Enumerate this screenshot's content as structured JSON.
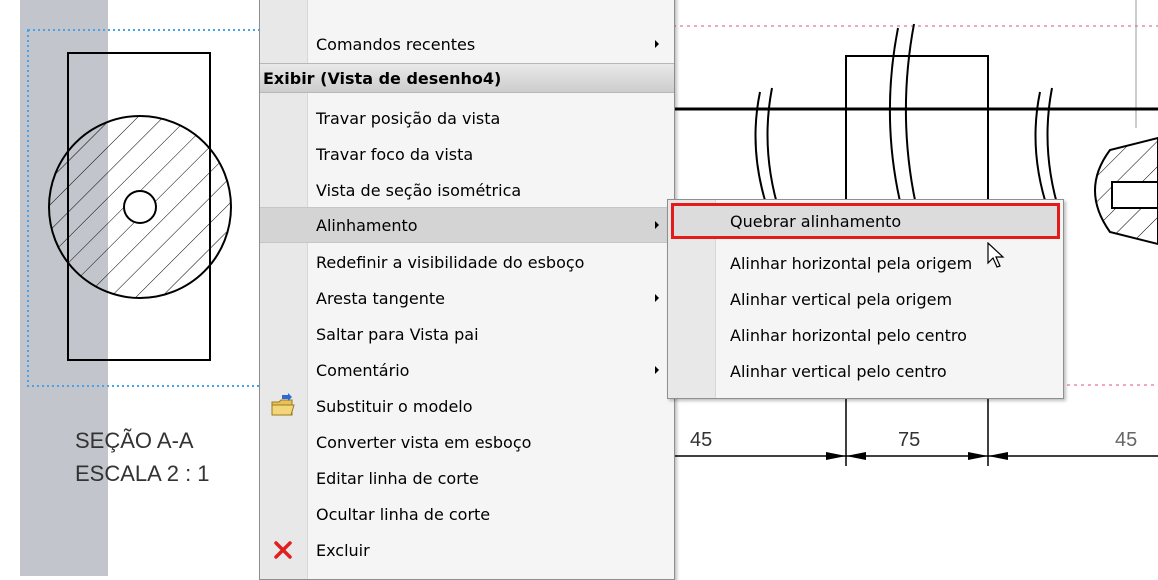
{
  "drawing": {
    "section_label": "SEÇÃO A-A",
    "scale_label": "ESCALA 2 : 1",
    "dimensions": [
      "45",
      "75",
      "45"
    ]
  },
  "context_menu": {
    "items_top": [
      {
        "label": "Comandos recentes",
        "has_submenu": true
      }
    ],
    "header": "Exibir (Vista de desenho4)",
    "items": [
      {
        "label": "Travar posição da vista",
        "has_submenu": false
      },
      {
        "label": "Travar foco da vista",
        "has_submenu": false
      },
      {
        "label": "Vista de seção isométrica",
        "has_submenu": false
      },
      {
        "label": "Alinhamento",
        "has_submenu": true,
        "highlighted": true
      },
      {
        "label": "Redefinir a visibilidade do esboço",
        "has_submenu": false
      },
      {
        "label": "Aresta tangente",
        "has_submenu": true
      },
      {
        "label": "Saltar para Vista pai",
        "has_submenu": false
      },
      {
        "label": "Comentário",
        "has_submenu": true
      },
      {
        "label": "Substituir o modelo",
        "has_submenu": false,
        "icon": "folder-swap-icon"
      },
      {
        "label": "Converter vista em esboço",
        "has_submenu": false
      },
      {
        "label": "Editar linha de corte",
        "has_submenu": false
      },
      {
        "label": "Ocultar linha de corte",
        "has_submenu": false
      },
      {
        "label": "Excluir",
        "has_submenu": false,
        "icon": "delete-x-icon"
      }
    ]
  },
  "submenu": {
    "items": [
      {
        "label": "Quebrar alinhamento",
        "highlighted": true
      },
      {
        "label": "Alinhar horizontal pela origem"
      },
      {
        "label": "Alinhar vertical pela origem"
      },
      {
        "label": "Alinhar horizontal pelo centro"
      },
      {
        "label": "Alinhar vertical pelo centro"
      }
    ]
  },
  "colors": {
    "highlight_border": "#e31b1b",
    "view_border_dotted": "#4aa3e8",
    "delete_icon": "#e02020"
  }
}
